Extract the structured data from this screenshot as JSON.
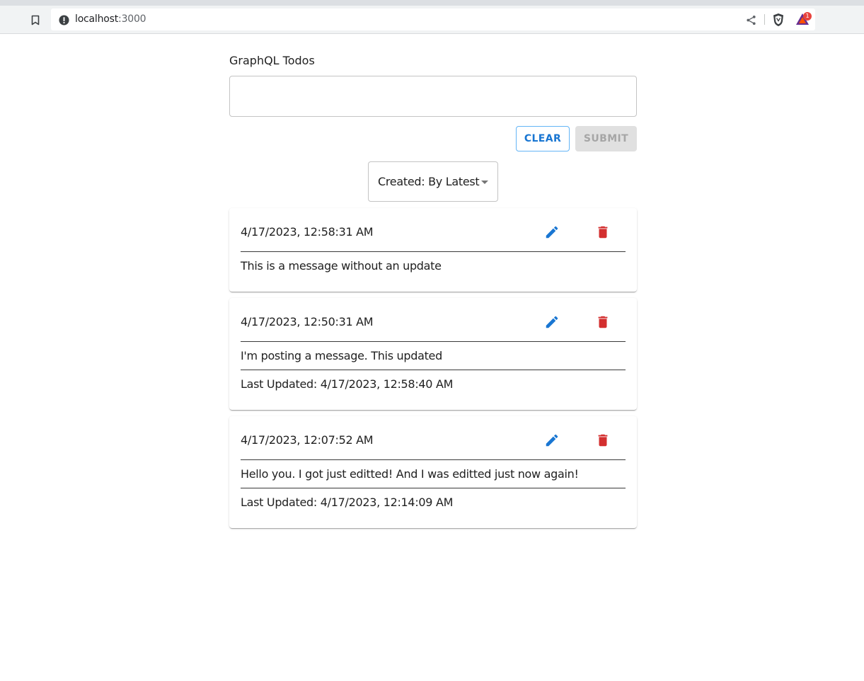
{
  "browser": {
    "url_host": "localhost",
    "url_port": ":3000",
    "rewards_badge": "1"
  },
  "app": {
    "title": "GraphQL Todos",
    "input_value": "",
    "clear_label": "CLEAR",
    "submit_label": "SUBMIT",
    "sort_value": "Created: By Latest"
  },
  "todos": [
    {
      "created": "4/17/2023, 12:58:31 AM",
      "message": "This is a message without an update",
      "last_updated": ""
    },
    {
      "created": "4/17/2023, 12:50:31 AM",
      "message": "I'm posting a message. This updated",
      "last_updated": "Last Updated: 4/17/2023, 12:58:40 AM"
    },
    {
      "created": "4/17/2023, 12:07:52 AM",
      "message": "Hello you. I got just editted! And I was editted just now again!",
      "last_updated": "Last Updated: 4/17/2023, 12:14:09 AM"
    }
  ],
  "colors": {
    "primary": "#1976d2",
    "danger": "#d32f2f",
    "disabled_bg": "#e0e0e0",
    "disabled_text": "#a6a6a6"
  }
}
